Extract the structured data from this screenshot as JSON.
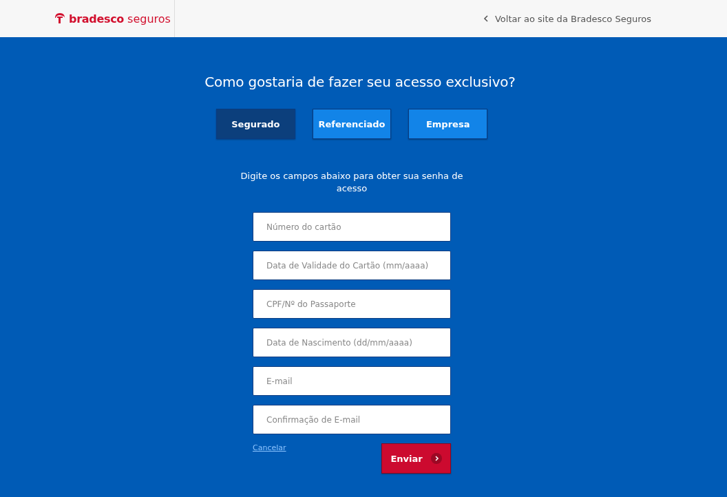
{
  "header": {
    "logo": {
      "brand": "bradesco",
      "product": "seguros"
    },
    "back_link": "Voltar ao site da Bradesco Seguros"
  },
  "title": "Como gostaria de fazer seu acesso exclusivo?",
  "tabs": [
    {
      "label": "Segurado",
      "selected": true
    },
    {
      "label": "Referenciado",
      "selected": false
    },
    {
      "label": "Empresa",
      "selected": false
    }
  ],
  "instructions": "Digite os campos abaixo para obter sua senha de acesso",
  "fields": [
    {
      "placeholder": "Número do cartão"
    },
    {
      "placeholder": "Data de Validade do Cartão (mm/aaaa)"
    },
    {
      "placeholder": "CPF/Nº do Passaporte"
    },
    {
      "placeholder": "Data de Nascimento (dd/mm/aaaa)"
    },
    {
      "placeholder": "E-mail"
    },
    {
      "placeholder": "Confirmação de E-mail"
    }
  ],
  "cancel_link": "Cancelar",
  "submit_button": "Enviar"
}
